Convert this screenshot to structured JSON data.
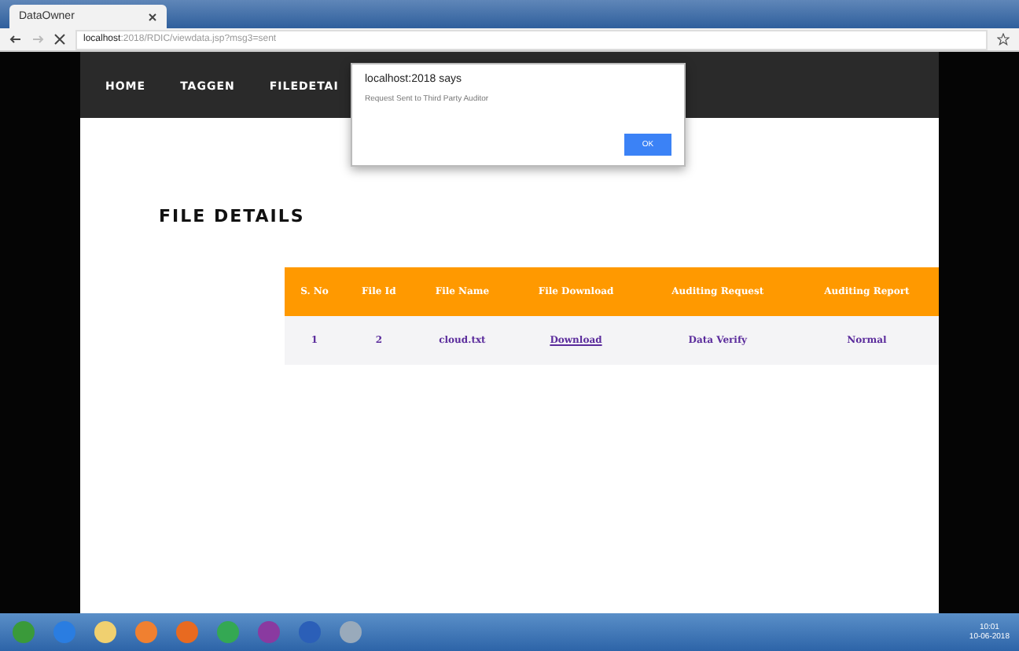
{
  "browser": {
    "tab_title": "DataOwner",
    "url_host": "localhost",
    "url_rest": ":2018/RDIC/viewdata.jsp?msg3=sent"
  },
  "nav": [
    {
      "label": "HOME"
    },
    {
      "label": "TAGGEN"
    },
    {
      "label": "FILEDETAI"
    }
  ],
  "dialog": {
    "title": "localhost:2018 says",
    "message": "Request Sent to Third Party Auditor",
    "button": "OK"
  },
  "heading": "FILE DETAILS",
  "table": {
    "columns": [
      "S. No",
      "File Id",
      "File Name",
      "File Download",
      "Auditing Request",
      "Auditing Report"
    ],
    "rows": [
      {
        "cells": [
          {
            "text": "1",
            "kind": "plain"
          },
          {
            "text": "2",
            "kind": "plain"
          },
          {
            "text": "cloud.txt",
            "kind": "plain"
          },
          {
            "text": "Download",
            "kind": "link"
          },
          {
            "text": "Data Verify",
            "kind": "plain"
          },
          {
            "text": "Normal",
            "kind": "plain"
          }
        ]
      }
    ]
  },
  "taskbar": {
    "time": "10:01",
    "date": "10-06-2018"
  }
}
